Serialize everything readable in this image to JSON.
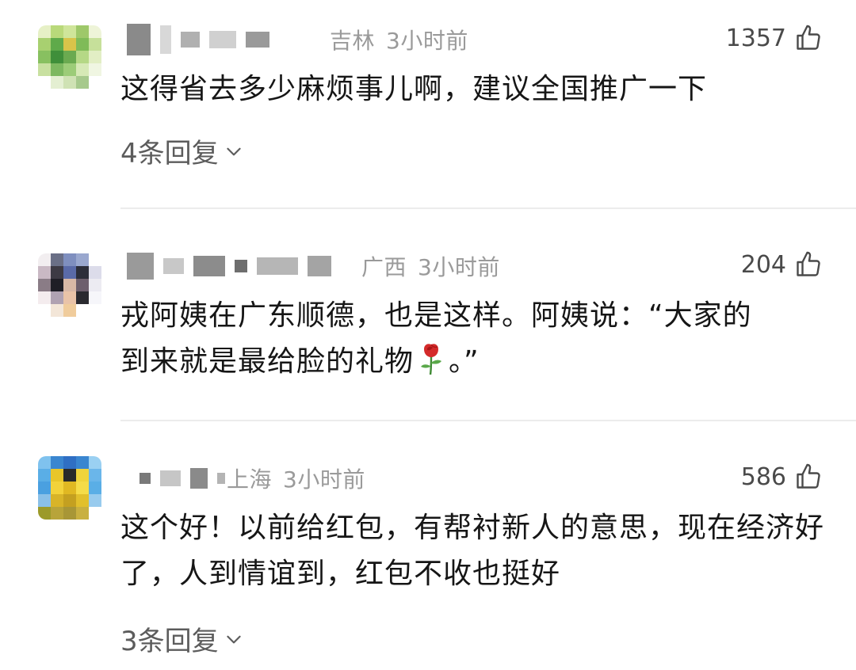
{
  "comments": [
    {
      "location": "吉林",
      "time": "3小时前",
      "likes": "1357",
      "text": "这得省去多少麻烦事儿啊，建议全国推广一下",
      "replies": "4条回复"
    },
    {
      "location": "广西",
      "time": "3小时前",
      "likes": "204",
      "text_line1": "戎阿姨在广东顺德，也是这样。阿姨说：“大家的",
      "text_line2_before": "到来就是最给脸的礼物",
      "text_line2_after": "。”",
      "emoji": "rose-emoji"
    },
    {
      "location": "上海",
      "time": "3小时前",
      "likes": "586",
      "text": "这个好！以前给红包，有帮衬新人的意思，现在经济好了，人到情谊到，红包不收也挺好",
      "replies": "3条回复"
    }
  ],
  "icons": {
    "like": "thumbs-up-icon",
    "expand": "chevron-down-icon"
  },
  "colors": {
    "meta": "#9a9a9a",
    "body_text": "#161616",
    "divider": "#ececec"
  }
}
